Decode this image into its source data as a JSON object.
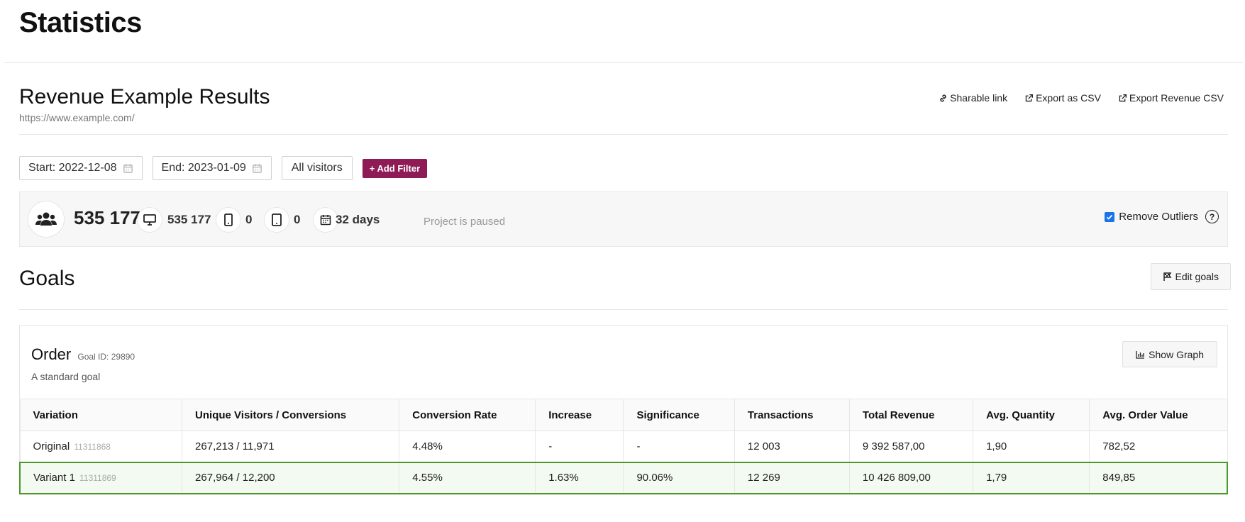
{
  "page": {
    "title": "Statistics"
  },
  "project": {
    "title": "Revenue Example Results",
    "url": "https://www.example.com/"
  },
  "links": {
    "sharable": "Sharable link",
    "export_csv": "Export as CSV",
    "export_revenue_csv": "Export Revenue CSV"
  },
  "filters": {
    "start": "Start: 2022-12-08",
    "end": "End: 2023-01-09",
    "audience": "All visitors",
    "add_filter": "+ Add Filter"
  },
  "stats": {
    "visitors_total": "535 177",
    "desktop": "535 177",
    "mobile": "0",
    "tablet": "0",
    "duration": "32 days",
    "status": "Project is paused",
    "remove_outliers_label": "Remove Outliers",
    "remove_outliers_checked": true
  },
  "goals": {
    "title": "Goals",
    "edit_label": "Edit goals",
    "goal": {
      "name": "Order",
      "id_label": "Goal ID: 29890",
      "description": "A standard goal",
      "show_graph": "Show Graph",
      "columns": [
        "Variation",
        "Unique Visitors / Conversions",
        "Conversion Rate",
        "Increase",
        "Significance",
        "Transactions",
        "Total Revenue",
        "Avg. Quantity",
        "Avg. Order Value"
      ],
      "rows": [
        {
          "variation": "Original",
          "variation_id": "11311868",
          "visitors_conversions": "267,213 / 11,971",
          "conversion_rate": "4.48%",
          "increase": "-",
          "significance": "-",
          "transactions": "12 003",
          "total_revenue": "9 392 587,00",
          "avg_quantity": "1,90",
          "avg_order_value": "782,52"
        },
        {
          "variation": "Variant 1",
          "variation_id": "11311869",
          "visitors_conversions": "267,964 / 12,200",
          "conversion_rate": "4.55%",
          "increase": "1.63%",
          "significance": "90.06%",
          "transactions": "12 269",
          "total_revenue": "10 426 809,00",
          "avg_quantity": "1,79",
          "avg_order_value": "849,85"
        }
      ]
    }
  },
  "colors": {
    "accent": "#8e1b56",
    "winner_border": "#4a9a2a",
    "checkbox": "#1a73e8"
  }
}
